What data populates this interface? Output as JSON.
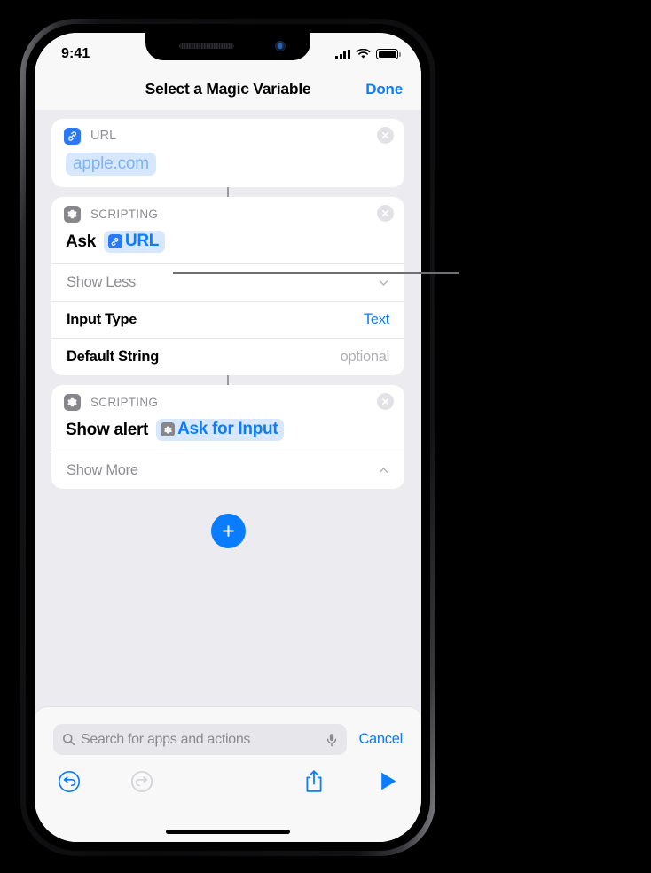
{
  "status_bar": {
    "time": "9:41",
    "signal_icon": "cellular-bars-icon",
    "wifi_icon": "wifi-icon",
    "battery_icon": "battery-icon"
  },
  "nav": {
    "title": "Select a Magic Variable",
    "done_label": "Done"
  },
  "cards": [
    {
      "icon": "link-icon",
      "header_label": "URL",
      "close_icon": "close-icon",
      "value_pill": "apple.com"
    },
    {
      "icon": "gear-icon",
      "header_label": "SCRIPTING",
      "close_icon": "close-icon",
      "body_prefix": "Ask",
      "body_pill": {
        "icon": "link-icon",
        "text": "URL"
      },
      "rows": [
        {
          "label": "Show Less",
          "value": "",
          "chevron": "chevron-down-icon"
        },
        {
          "label": "Input Type",
          "value": "Text"
        },
        {
          "label": "Default String",
          "value": "optional"
        }
      ]
    },
    {
      "icon": "gear-icon",
      "header_label": "SCRIPTING",
      "close_icon": "close-icon",
      "body_prefix": "Show alert",
      "body_pill": {
        "icon": "gear-icon",
        "text": "Ask for Input"
      },
      "rows": [
        {
          "label": "Show More",
          "value": "",
          "chevron": "chevron-up-icon"
        }
      ]
    }
  ],
  "add_button": {
    "icon": "plus-icon"
  },
  "search": {
    "placeholder": "Search for apps and actions",
    "search_icon": "search-icon",
    "mic_icon": "microphone-icon",
    "cancel_label": "Cancel"
  },
  "toolbar": {
    "undo_icon": "undo-icon",
    "redo_icon": "redo-icon",
    "share_icon": "share-icon",
    "play_icon": "play-icon"
  },
  "colors": {
    "accent": "#0a7cff",
    "pill_bg": "#d7e7fd",
    "app_blue": "#2979f5",
    "app_gray": "#86868b",
    "screen_bg": "#ececf0"
  }
}
